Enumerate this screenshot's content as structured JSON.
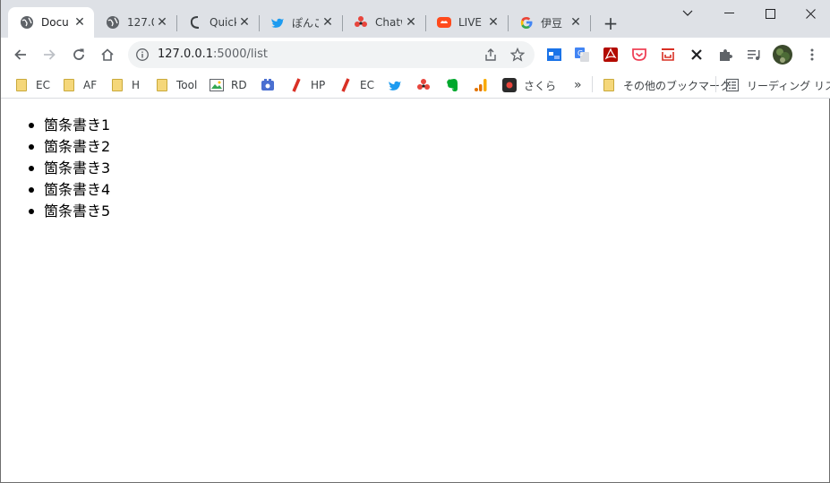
{
  "tabs": [
    {
      "title": "Docu",
      "active": true,
      "icon": "globe-icon"
    },
    {
      "title": "127.0",
      "active": false,
      "icon": "globe-icon"
    },
    {
      "title": "Quick",
      "active": false,
      "icon": "quick-icon"
    },
    {
      "title": "ぽんこ",
      "active": false,
      "icon": "twitter-icon"
    },
    {
      "title": "Chatw",
      "active": false,
      "icon": "chatwork-icon"
    },
    {
      "title": "LIVE",
      "active": false,
      "icon": "live-icon"
    },
    {
      "title": "伊豆",
      "active": false,
      "icon": "google-icon"
    }
  ],
  "address": {
    "host": "127.0.0.1",
    "path": ":5000/list"
  },
  "bookmarks": [
    {
      "label": "EC",
      "icon": "folder-icon"
    },
    {
      "label": "AF",
      "icon": "folder-icon"
    },
    {
      "label": "H",
      "icon": "folder-icon"
    },
    {
      "label": "Tool",
      "icon": "folder-icon"
    },
    {
      "label": "RD",
      "icon": "image-icon"
    },
    {
      "label": "",
      "icon": "app-icon"
    },
    {
      "label": "HP",
      "icon": "slash-icon"
    },
    {
      "label": "EC",
      "icon": "slash-icon"
    },
    {
      "label": "",
      "icon": "twitter-icon"
    },
    {
      "label": "",
      "icon": "chatwork-icon"
    },
    {
      "label": "",
      "icon": "evernote-icon"
    },
    {
      "label": "",
      "icon": "analytics-icon"
    },
    {
      "label": "さくら",
      "icon": "sakura-icon"
    }
  ],
  "other_bookmarks": "その他のブックマーク",
  "reading_list": "リーディング リスト",
  "colors": {
    "accent_red": "#e8453c",
    "twitter": "#1d9bf0",
    "folder": "#f5d77a"
  },
  "content": {
    "items": [
      "箇条書き1",
      "箇条書き2",
      "箇条書き3",
      "箇条書き4",
      "箇条書き5"
    ]
  }
}
